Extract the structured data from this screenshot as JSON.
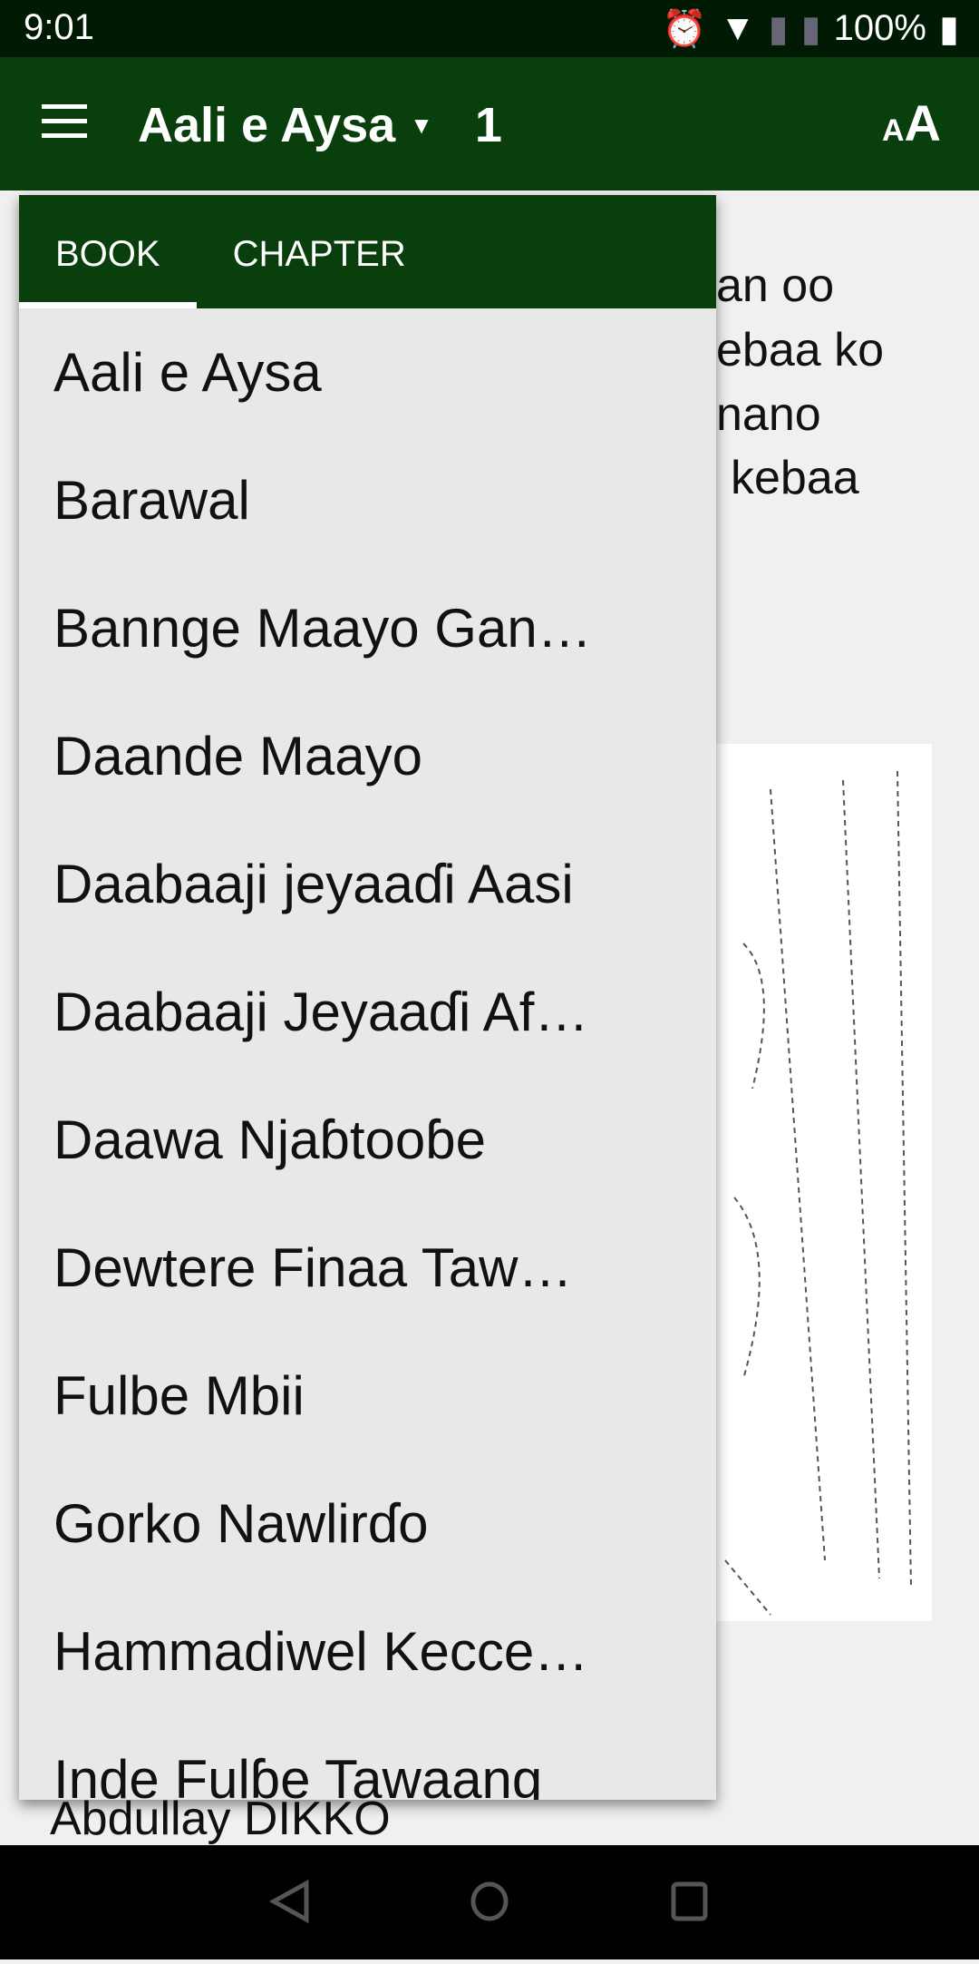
{
  "status": {
    "time": "9:01",
    "battery": "100%"
  },
  "toolbar": {
    "book": "Aali e Aysa",
    "chapter": "1",
    "font_icon": "aA"
  },
  "tabs": [
    "BOOK",
    "CHAPTER"
  ],
  "books": [
    "Aali e Aysa",
    "Barawal",
    "Bannge Maayo Gan…",
    "Daande Maayo",
    "Daabaaji jeyaaɗi Aasi",
    "Daabaaji Jeyaaɗi Af…",
    "Daawa Njaɓtooɓe",
    "Dewtere Finaa Taw…",
    "Fulbe Mbii",
    "Gorko Nawlirɗo",
    "Hammadiwel Kecce…",
    "Inde Fulɓe Tawaang"
  ],
  "background": {
    "lines": [
      "an oo",
      "ebaa ko",
      "nano",
      "kebaa"
    ],
    "author": "Abdullay DIKKO"
  },
  "colors": {
    "primary": "#083f0d",
    "status_bar": "#011a04"
  }
}
